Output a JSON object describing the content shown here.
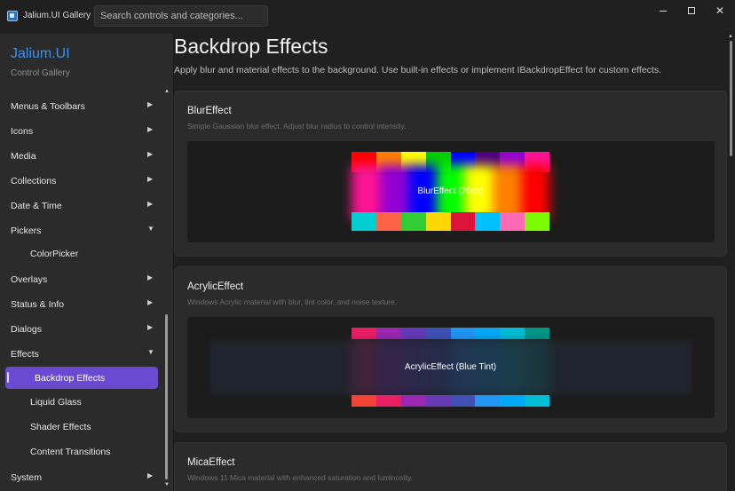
{
  "window": {
    "title": "Jalium.UI Gallery",
    "search_placeholder": "Search controls and categories..."
  },
  "sidebar": {
    "brand": "Jalium.UI",
    "subtitle": "Control Gallery",
    "items": [
      {
        "label": "Menus & Toolbars",
        "expanded": false
      },
      {
        "label": "Icons",
        "expanded": false
      },
      {
        "label": "Media",
        "expanded": false
      },
      {
        "label": "Collections",
        "expanded": false
      },
      {
        "label": "Date & Time",
        "expanded": false
      },
      {
        "label": "Pickers",
        "expanded": true
      },
      {
        "label": "ColorPicker",
        "child": true
      },
      {
        "label": "Overlays",
        "expanded": false
      },
      {
        "label": "Status & Info",
        "expanded": false
      },
      {
        "label": "Dialogs",
        "expanded": false
      },
      {
        "label": "Effects",
        "expanded": true
      },
      {
        "label": "Backdrop Effects",
        "child": true,
        "selected": true
      },
      {
        "label": "Liquid Glass",
        "child": true
      },
      {
        "label": "Shader Effects",
        "child": true
      },
      {
        "label": "Content Transitions",
        "child": true
      },
      {
        "label": "System",
        "expanded": false
      }
    ]
  },
  "main": {
    "title": "Backdrop Effects",
    "description": "Apply blur and material effects to the background. Use built-in effects or implement IBackdropEffect for custom effects.",
    "cards": [
      {
        "title": "BlurEffect",
        "description": "Simple Gaussian blur effect. Adjust blur radius to control intensity.",
        "demo_label": "BlurEffect (20px)"
      },
      {
        "title": "AcrylicEffect",
        "description": "Windows Acrylic material with blur, tint color, and noise texture.",
        "demo_label": "AcrylicEffect (Blue Tint)"
      },
      {
        "title": "MicaEffect",
        "description": "Windows 11 Mica material with enhanced saturation and luminosity."
      }
    ]
  },
  "colors": {
    "accent": "#6a4ad0",
    "brand": "#3e91e6",
    "blur_top": [
      "#ff0000",
      "#ff8000",
      "#ffff00",
      "#00d000",
      "#0000ff",
      "#4b0082",
      "#9400d3",
      "#ff1493"
    ],
    "blur_mid": [
      "#ff1493",
      "#9400d3",
      "#0000ff",
      "#00ff00",
      "#ffff00",
      "#ff8000",
      "#ff0000"
    ],
    "blur_bottom": [
      "#00ced1",
      "#ff6347",
      "#32cd32",
      "#ffd700",
      "#dc143c",
      "#00bfff",
      "#ff69b4",
      "#7cfc00"
    ],
    "acrylic_top": [
      "#e91e63",
      "#9c27b0",
      "#673ab7",
      "#3f51b5",
      "#2196f3",
      "#03a9f4",
      "#00bcd4",
      "#009688"
    ],
    "acrylic_mid": [
      "#c2185b",
      "#7b1fa2",
      "#512da8",
      "#303f9f",
      "#1976d2",
      "#0288d1",
      "#0097a7",
      "#00796b"
    ],
    "acrylic_bottom": [
      "#f44336",
      "#e91e63",
      "#9c27b0",
      "#673ab7",
      "#3f51b5",
      "#2196f3",
      "#03a9f4",
      "#00bcd4"
    ]
  }
}
